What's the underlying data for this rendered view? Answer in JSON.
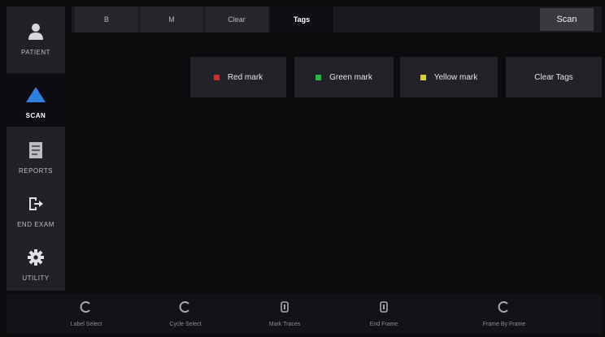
{
  "sidebar": {
    "items": [
      {
        "label": "PATIENT",
        "icon": "user-icon",
        "active": false
      },
      {
        "label": "SCAN",
        "icon": "scan-probe-icon",
        "active": true
      },
      {
        "label": "REPORTS",
        "icon": "report-icon",
        "active": false
      },
      {
        "label": "END EXAM",
        "icon": "exit-icon",
        "active": false
      },
      {
        "label": "UTILITY",
        "icon": "gear-icon",
        "active": false
      }
    ]
  },
  "tabs": [
    {
      "label": "B",
      "active": false
    },
    {
      "label": "M",
      "active": false
    },
    {
      "label": "Clear",
      "active": false
    },
    {
      "label": "Tags",
      "active": true
    }
  ],
  "corner_button": {
    "label": "Scan"
  },
  "tag_buttons": [
    {
      "label": "Red mark",
      "color": "#d42a2a"
    },
    {
      "label": "Green mark",
      "color": "#2fb14a"
    },
    {
      "label": "Yellow mark",
      "color": "#e0d020"
    },
    {
      "label": "Clear Tags",
      "color": null
    }
  ],
  "bottom_controls": [
    {
      "label": "Label Select",
      "icon": "rotary-knob-icon"
    },
    {
      "label": "Cycle Select",
      "icon": "rotary-knob-icon"
    },
    {
      "label": "Mark Traces",
      "icon": "push-knob-icon"
    },
    {
      "label": "End Frame",
      "icon": "push-knob-icon"
    },
    {
      "label": "Frame By Frame",
      "icon": "rotary-knob-icon"
    }
  ]
}
